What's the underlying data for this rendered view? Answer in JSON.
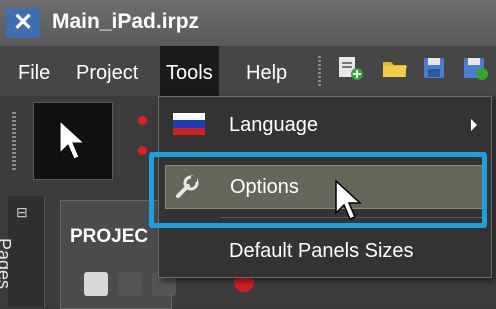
{
  "window": {
    "title": "Main_iPad.irpz",
    "app_icon": "app-tools-icon"
  },
  "menubar": {
    "items": [
      {
        "label": "File"
      },
      {
        "label": "Project"
      },
      {
        "label": "Tools",
        "active": true
      },
      {
        "label": "Help"
      }
    ]
  },
  "toolbar": {
    "icons": [
      "new-page-icon",
      "open-folder-icon",
      "save-icon",
      "save-all-icon"
    ]
  },
  "tools_menu": {
    "items": [
      {
        "label": "Language",
        "icon": "russian-flag-icon",
        "has_submenu": true
      },
      {
        "label": "Options",
        "icon": "wrench-icon",
        "hovered": true
      },
      {
        "label": "Default Panels Sizes"
      }
    ]
  },
  "left_panel": {
    "tab_label": "Pages"
  },
  "project_panel": {
    "header": "PROJEC"
  },
  "colors": {
    "highlight": "#1e9fe0",
    "hover": "#66675a",
    "menu_bg": "#333333"
  }
}
